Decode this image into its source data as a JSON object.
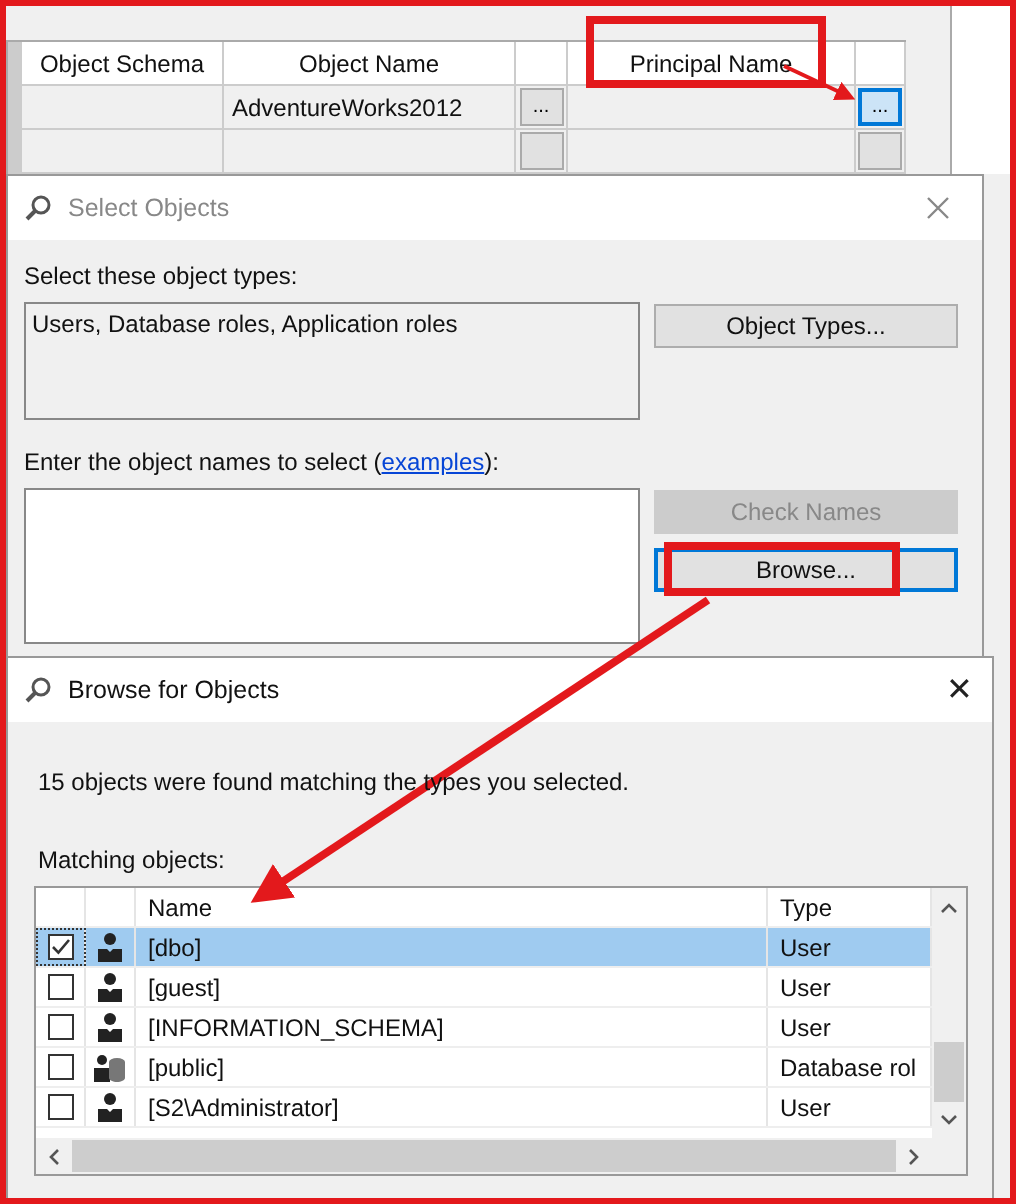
{
  "grid": {
    "columns": [
      "Object Schema",
      "Object Name",
      "Principal Name"
    ],
    "rows": [
      {
        "object_name": "AdventureWorks2012",
        "name_button": "...",
        "principal_button": "...",
        "focused": true
      },
      {
        "focused": false
      }
    ]
  },
  "select_dialog": {
    "title": "Select Objects",
    "types_label": "Select these object types:",
    "types_value": "Users, Database roles, Application roles",
    "object_types_button": "Object Types...",
    "names_label_before": "Enter the object names to select (",
    "names_link": "examples",
    "names_label_after": "):",
    "check_names_button": {
      "label": "Check Names",
      "disabled": true
    },
    "browse_button": {
      "label": "Browse...",
      "focused": true
    }
  },
  "browse_dialog": {
    "title": "Browse for Objects",
    "close": "✕",
    "summary": "15 objects were found matching the types you selected.",
    "matching_label": "Matching objects:",
    "columns": [
      "Name",
      "Type"
    ],
    "rows": [
      {
        "name": "[dbo]",
        "type": "User",
        "kind": "user",
        "checked": true,
        "selected": true
      },
      {
        "name": "[guest]",
        "type": "User",
        "kind": "user",
        "checked": false,
        "selected": false
      },
      {
        "name": "[INFORMATION_SCHEMA]",
        "type": "User",
        "kind": "user",
        "checked": false,
        "selected": false
      },
      {
        "name": "[public]",
        "type": "Database rol",
        "kind": "role",
        "checked": false,
        "selected": false
      },
      {
        "name": "[S2\\Administrator]",
        "type": "User",
        "kind": "user",
        "checked": false,
        "selected": false
      }
    ]
  }
}
